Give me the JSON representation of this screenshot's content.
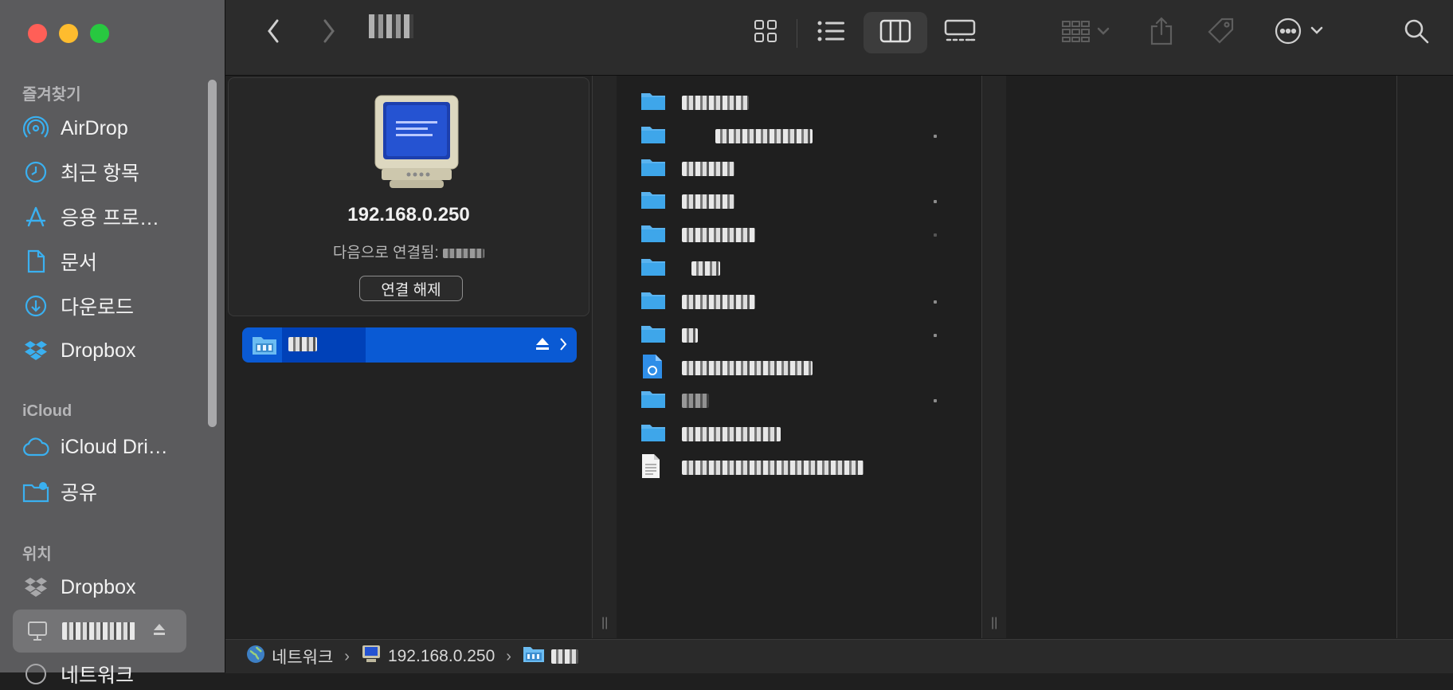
{
  "window": {
    "title": ""
  },
  "sidebar": {
    "favorites_label": "즐겨찾기",
    "favorites": [
      {
        "label": "AirDrop",
        "icon": "airdrop-icon"
      },
      {
        "label": "최근 항목",
        "icon": "clock-icon"
      },
      {
        "label": "응용 프로…",
        "icon": "applications-icon"
      },
      {
        "label": "문서",
        "icon": "document-icon"
      },
      {
        "label": "다운로드",
        "icon": "download-icon"
      },
      {
        "label": "Dropbox",
        "icon": "dropbox-icon"
      }
    ],
    "icloud_label": "iCloud",
    "icloud": [
      {
        "label": "iCloud Dri…",
        "icon": "cloud-icon"
      },
      {
        "label": "공유",
        "icon": "shared-folder-icon"
      }
    ],
    "locations_label": "위치",
    "locations": [
      {
        "label": "Dropbox",
        "icon": "dropbox-icon"
      },
      {
        "label": "",
        "icon": "server-display-icon"
      },
      {
        "label": "네트워크",
        "icon": "network-icon"
      }
    ]
  },
  "toolbar": {
    "views": [
      "icon-view",
      "list-view",
      "column-view",
      "gallery-view"
    ],
    "active_view": "column-view"
  },
  "server": {
    "address": "192.168.0.250",
    "connected_as_label": "다음으로 연결됨:",
    "connected_as_value": "",
    "disconnect_label": "연결 해제"
  },
  "share": {
    "name": ""
  },
  "files": [
    {
      "type": "folder",
      "name": "",
      "dot": false
    },
    {
      "type": "folder",
      "name": "",
      "dot": true
    },
    {
      "type": "folder",
      "name": "",
      "dot": false
    },
    {
      "type": "folder",
      "name": "",
      "dot": true
    },
    {
      "type": "folder",
      "name": "",
      "dot": true
    },
    {
      "type": "folder",
      "name": "",
      "dot": false
    },
    {
      "type": "folder",
      "name": "",
      "dot": true
    },
    {
      "type": "folder",
      "name": "",
      "dot": true
    },
    {
      "type": "app-document",
      "name": "",
      "dot": false
    },
    {
      "type": "folder",
      "name": "",
      "dot": true
    },
    {
      "type": "folder",
      "name": "",
      "dot": false
    },
    {
      "type": "text-document",
      "name": "",
      "dot": false
    }
  ],
  "pathbar": {
    "items": [
      {
        "label": "네트워크",
        "icon": "network-globe-icon"
      },
      {
        "label": "192.168.0.250",
        "icon": "server-display-icon"
      },
      {
        "label": "",
        "icon": "share-folder-icon"
      }
    ]
  },
  "colors": {
    "accent": "#0a5ad4",
    "folder": "#3ea6ea",
    "sidebar_bg": "#5b5b5d"
  }
}
